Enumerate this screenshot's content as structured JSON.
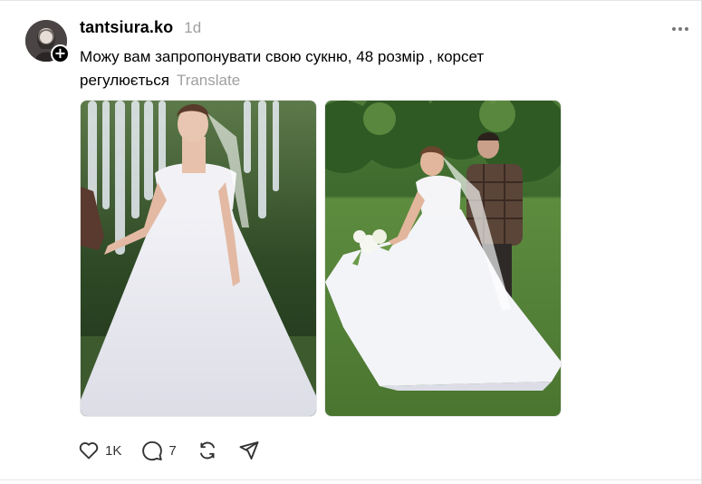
{
  "post": {
    "username": "tantsiura.ko",
    "time": "1d",
    "text": "Можу вам запропонувати свою сукню, 48 розмір , корсет регулюється",
    "translate_label": "Translate"
  },
  "avatar": {
    "badge": "+"
  },
  "images": [
    {
      "description_icon": "photo-bride-in-garden"
    },
    {
      "description_icon": "photo-bride-walking-on-lawn"
    }
  ],
  "actions": {
    "likes": "1K",
    "comments": "7"
  },
  "colors": {
    "muted_text": "#a0a0a0",
    "icon": "#333333"
  }
}
